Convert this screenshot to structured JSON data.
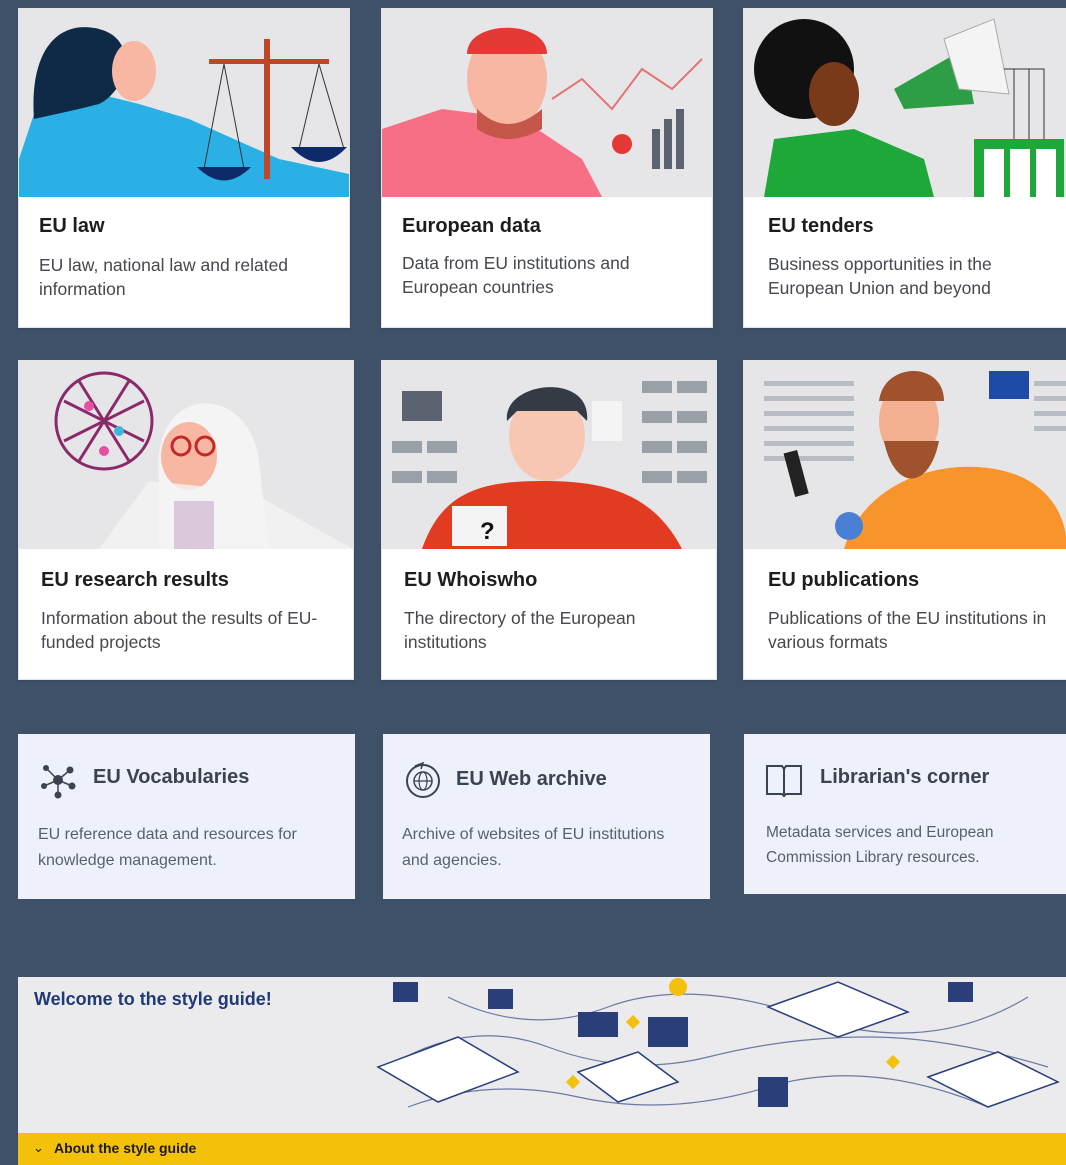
{
  "cards": [
    {
      "title": "EU law",
      "desc": "EU law, national law and related information",
      "illustration": "woman-with-scales"
    },
    {
      "title": "European data",
      "desc": "Data from EU institutions and European countries",
      "illustration": "man-viewing-data"
    },
    {
      "title": "EU tenders",
      "desc": "Business opportunities in the European Union and beyond",
      "illustration": "woman-with-megaphone"
    },
    {
      "title": "EU research results",
      "desc": "Information about the results of EU-funded projects",
      "illustration": "scientist-with-molecule"
    },
    {
      "title": "EU Whoiswho",
      "desc": "The directory of the European institutions",
      "illustration": "man-with-org-chart"
    },
    {
      "title": "EU publications",
      "desc": "Publications of the EU institutions in various formats",
      "illustration": "man-reading-phone"
    }
  ],
  "tools": [
    {
      "title": "EU Vocabularies",
      "desc": "EU reference data and resources for knowledge management.",
      "icon": "network-nodes-icon"
    },
    {
      "title": "EU Web archive",
      "desc": "Archive of websites of EU institutions and agencies.",
      "icon": "globe-archive-icon"
    },
    {
      "title": "Librarian's corner",
      "desc": "Metadata services and European Commission Library resources.",
      "icon": "open-book-icon"
    }
  ],
  "banner": {
    "title": "Welcome to the style guide!",
    "toggle_label": "About the style guide",
    "toggle_icon": "chevron-down-icon"
  },
  "colors": {
    "background": "#3f5169",
    "tool_bg": "#eef1f9",
    "banner_bar": "#f4c10a",
    "banner_title": "#1f3a75"
  }
}
